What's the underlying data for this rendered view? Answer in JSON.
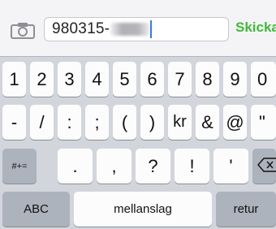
{
  "toolbar": {
    "camera_icon": "camera-icon",
    "input_value": "980315-",
    "send_label": "Skicka",
    "send_color": "#3fba3a"
  },
  "keyboard": {
    "row1": [
      "1",
      "2",
      "3",
      "4",
      "5",
      "6",
      "7",
      "8",
      "9",
      "0"
    ],
    "row2": [
      "-",
      "/",
      ":",
      ";",
      "(",
      ")",
      "kr",
      "&",
      "@",
      "\""
    ],
    "row3": {
      "more_symbols": "#+=",
      "keys": [
        ".",
        ",",
        "?",
        "!",
        "'"
      ],
      "delete_icon": "backspace-icon"
    },
    "row4": {
      "abc": "ABC",
      "space": "mellanslag",
      "return": "retur"
    }
  }
}
